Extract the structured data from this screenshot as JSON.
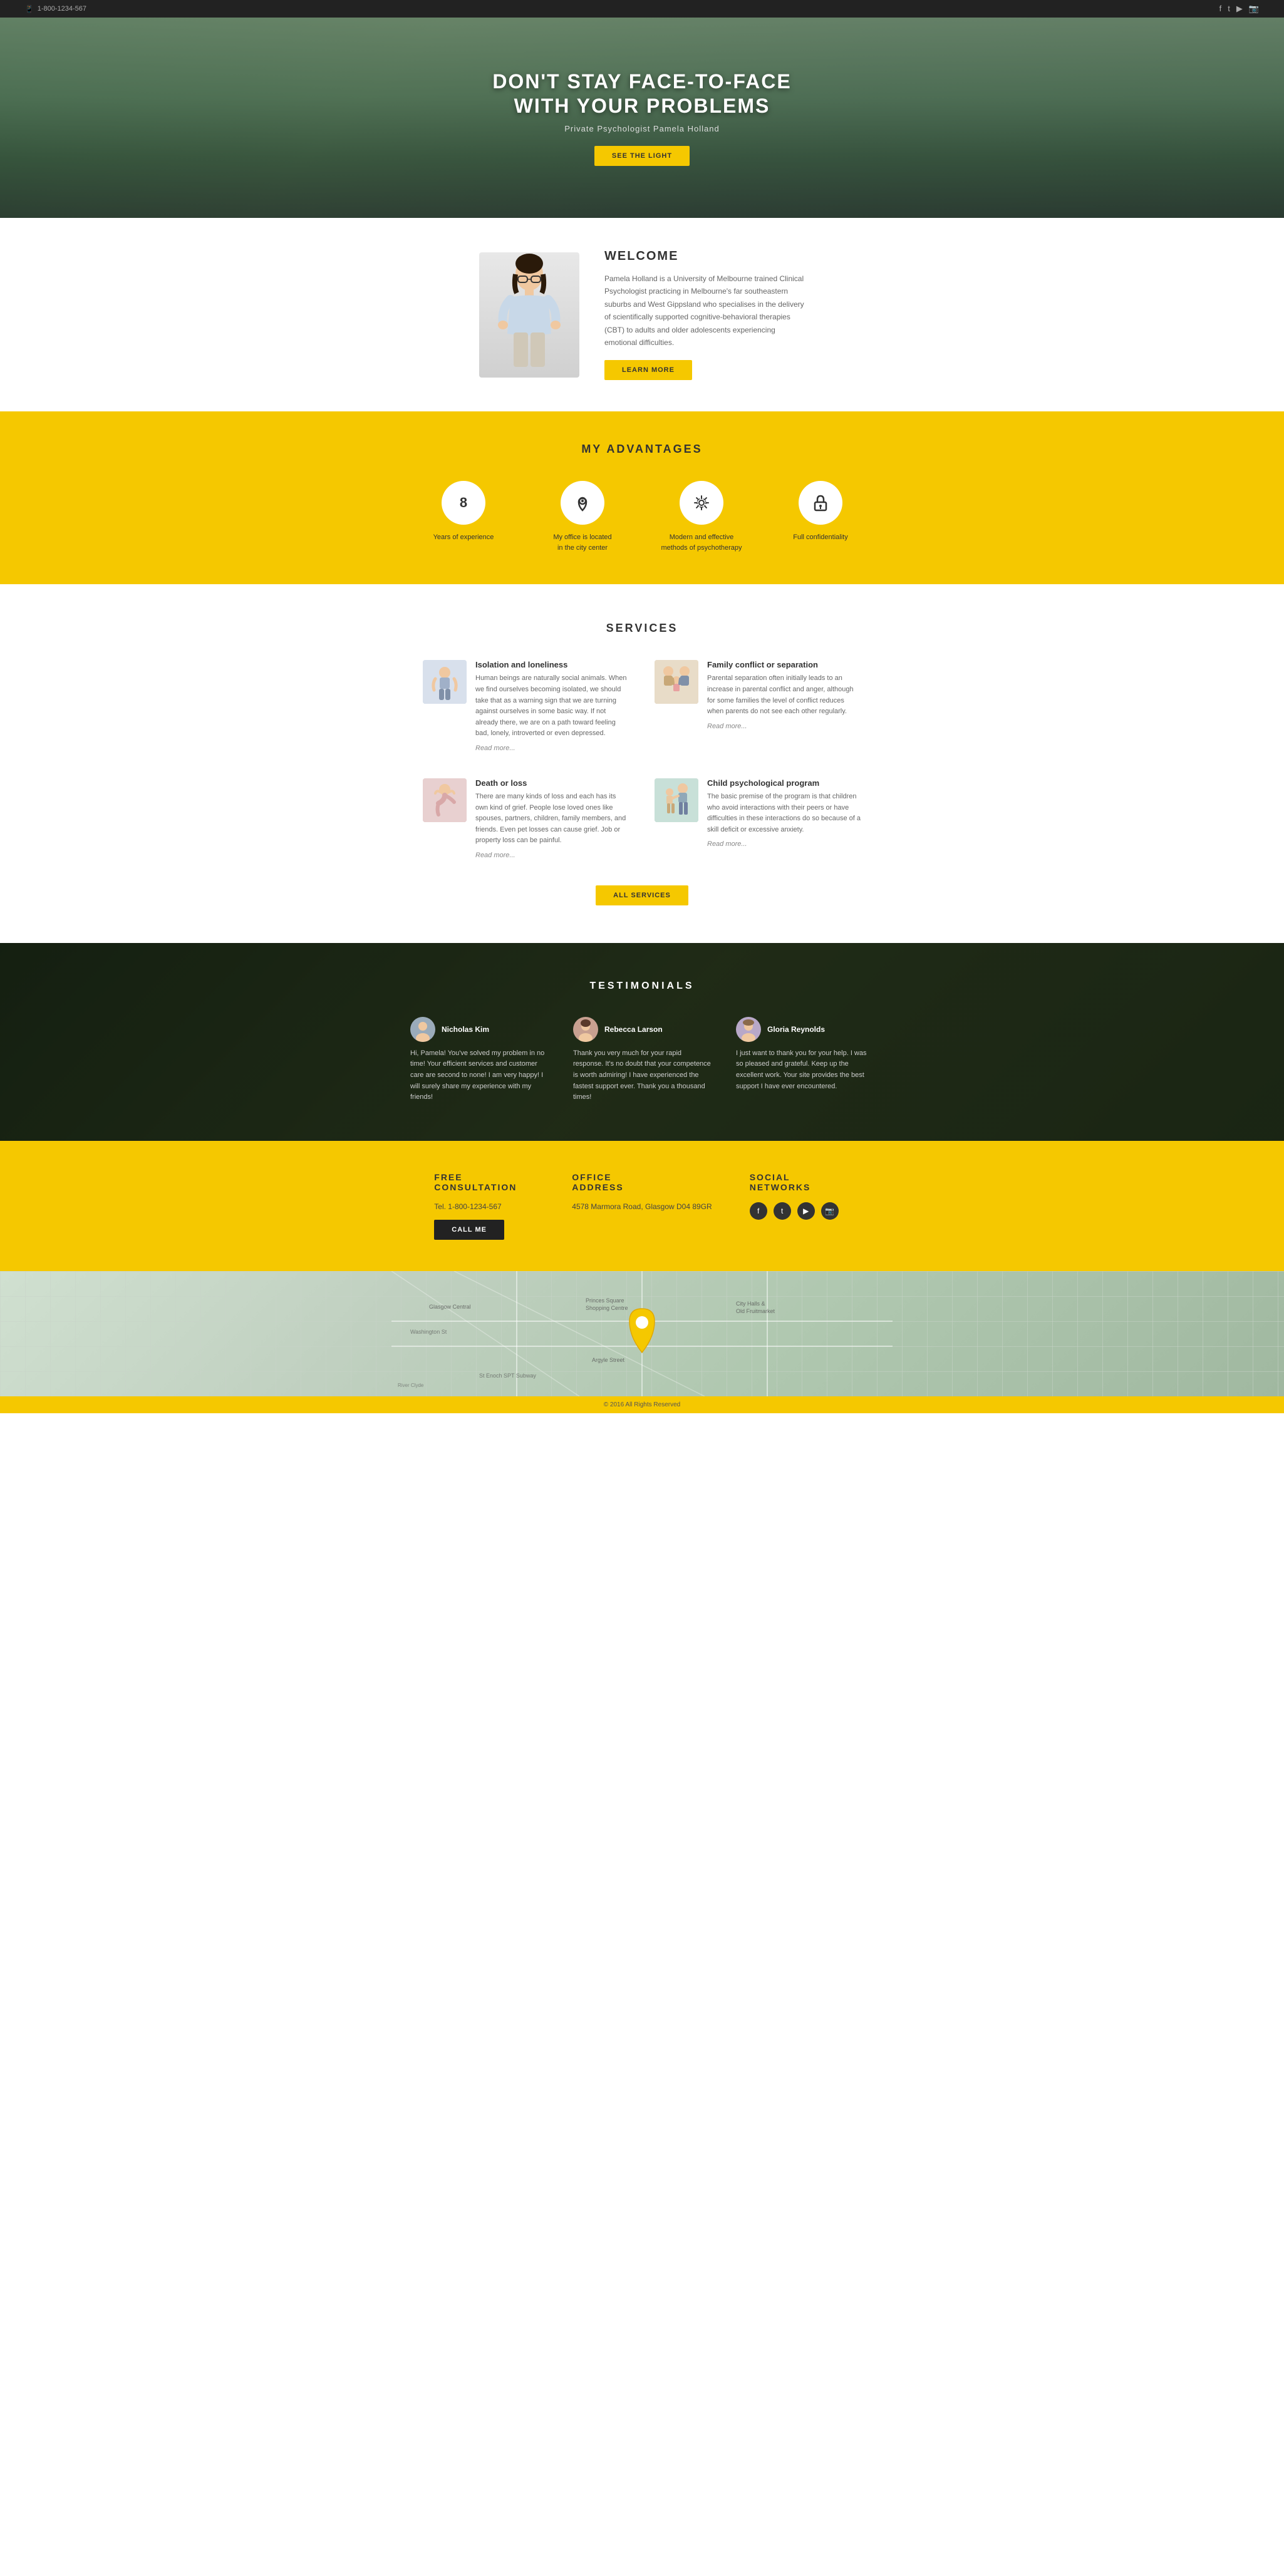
{
  "topbar": {
    "phone": "1-800-1234-567",
    "social": [
      "f",
      "t",
      "y",
      "i"
    ]
  },
  "hero": {
    "title_line1": "DON'T STAY FACE-TO-FACE",
    "title_line2": "WITH YOUR PROBLEMS",
    "subtitle": "Private Psychologist Pamela Holland",
    "cta_button": "SEE THE LIGHT"
  },
  "welcome": {
    "heading": "WELCOME",
    "body": "Pamela Holland is a University of Melbourne trained Clinical Psychologist practicing in Melbourne's far southeastern suburbs and West Gippsland who specialises in the delivery of scientifically supported cognitive-behavioral therapies (CBT) to adults and older adolescents experiencing emotional difficulties.",
    "button": "LEARN MORE"
  },
  "advantages": {
    "heading": "MY ADVANTAGES",
    "items": [
      {
        "icon": "8",
        "label": "Years of experience",
        "type": "number"
      },
      {
        "icon": "📍",
        "label": "My office is located\nin the city center",
        "type": "location"
      },
      {
        "icon": "⚙",
        "label": "Modern and effective\nmethods of psychotherapy",
        "type": "settings"
      },
      {
        "icon": "🔒",
        "label": "Full confidentiality",
        "type": "lock"
      }
    ]
  },
  "services": {
    "heading": "SERVICES",
    "items": [
      {
        "title": "Isolation and loneliness",
        "body": "Human beings are naturally social animals. When we find ourselves becoming isolated, we should take that as a warning sign that we are turning against ourselves in some basic way. If not already there, we are on a path toward feeling bad, lonely, introverted or even depressed.",
        "read_more": "Read more..."
      },
      {
        "title": "Family conflict or separation",
        "body": "Parental separation often initially leads to an increase in parental conflict and anger, although for some families the level of conflict reduces when parents do not see each other regularly.",
        "read_more": "Read more..."
      },
      {
        "title": "Death or loss",
        "body": "There are many kinds of loss and each has its own kind of grief. People lose loved ones like spouses, partners, children, family members, and friends. Even pet losses can cause grief. Job or property loss can be painful.",
        "read_more": "Read more..."
      },
      {
        "title": "Child psychological program",
        "body": "The basic premise of the program is that children who avoid interactions with their peers or have difficulties in these interactions do so because of a skill deficit or excessive anxiety.",
        "read_more": "Read more..."
      }
    ],
    "all_button": "ALL SERVICES"
  },
  "testimonials": {
    "heading": "TESTIMONIALS",
    "items": [
      {
        "name": "Nicholas Kim",
        "text": "Hi, Pamela! You've solved my problem in no time! Your efficient services and customer care are second to none! I am very happy! I will surely share my experience with my friends!"
      },
      {
        "name": "Rebecca Larson",
        "text": "Thank you very much for your rapid response. It's no doubt that your competence is worth admiring! I have experienced the fastest support ever. Thank you a thousand times!"
      },
      {
        "name": "Gloria Reynolds",
        "text": "I just want to thank you for your help. I was so pleased and grateful. Keep up the excellent work. Your site provides the best support I have ever encountered."
      }
    ]
  },
  "footer": {
    "consultation": {
      "heading": "FREE\nCONSULTATION",
      "phone": "Tel. 1-800-1234-567",
      "button": "CALL ME"
    },
    "address": {
      "heading": "OFFICE\nADDRESS",
      "text": "4578 Marmora Road,\nGlasgow D04 89GR"
    },
    "social": {
      "heading": "SOCIAL\nNETWORKS",
      "icons": [
        "f",
        "t",
        "y",
        "i"
      ]
    },
    "copyright": "© 2016 All Rights Reserved"
  }
}
